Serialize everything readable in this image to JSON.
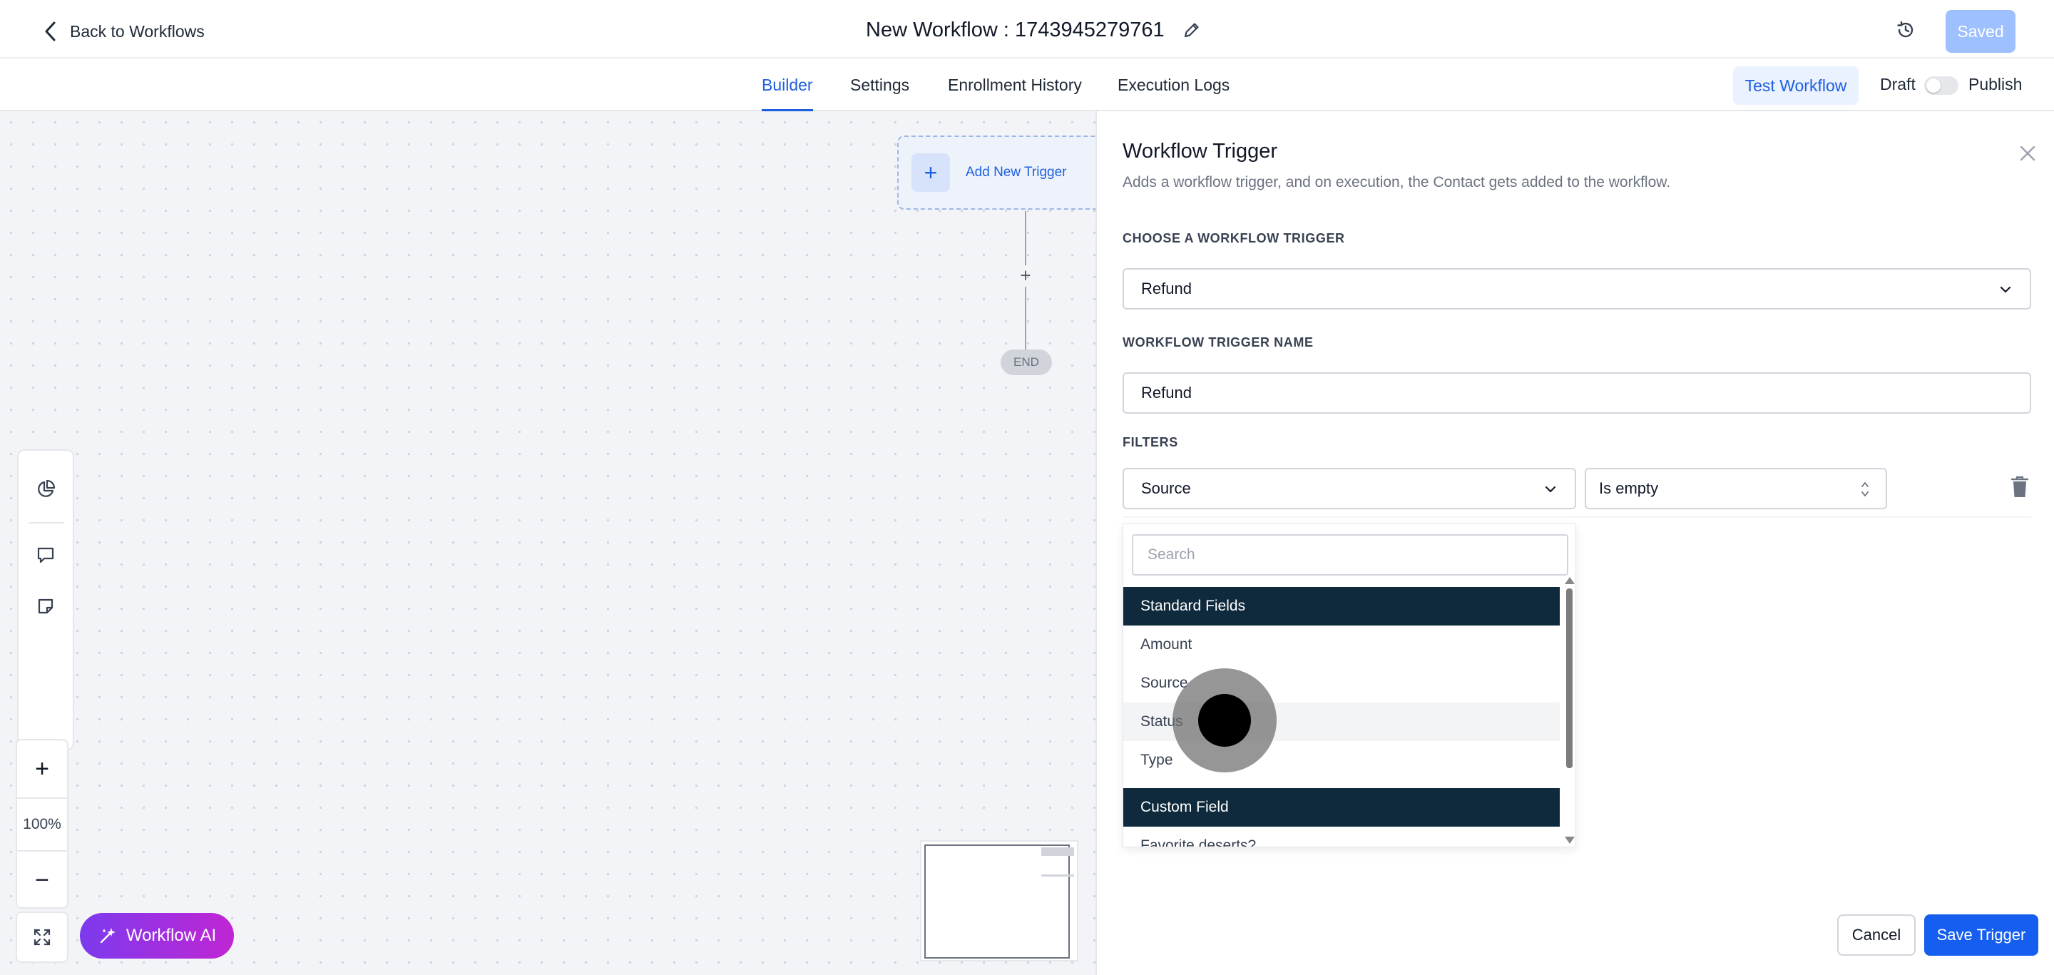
{
  "header": {
    "back_label": "Back to Workflows",
    "workflow_title": "New Workflow : 1743945279761",
    "saved_label": "Saved"
  },
  "tabs": [
    {
      "label": "Builder",
      "active": true
    },
    {
      "label": "Settings",
      "active": false
    },
    {
      "label": "Enrollment History",
      "active": false
    },
    {
      "label": "Execution Logs",
      "active": false
    }
  ],
  "toolbar": {
    "test_label": "Test Workflow",
    "draft_label": "Draft",
    "publish_label": "Publish",
    "published": false
  },
  "canvas": {
    "add_trigger_label": "Add New Trigger",
    "end_label": "END",
    "zoom_level": "100%",
    "ai_label": "Workflow AI"
  },
  "drawer": {
    "title": "Workflow Trigger",
    "description": "Adds a workflow trigger, and on execution, the Contact gets added to the workflow.",
    "choose_label": "CHOOSE A WORKFLOW TRIGGER",
    "trigger_value": "Refund",
    "name_label": "WORKFLOW TRIGGER NAME",
    "name_value": "Refund",
    "filters_label": "FILTERS",
    "filter_field": "Source",
    "filter_operator": "Is empty",
    "search_placeholder": "Search",
    "groups": [
      {
        "label": "Standard Fields",
        "items": [
          "Amount",
          "Source",
          "Status",
          "Type"
        ]
      },
      {
        "label": "Custom Field",
        "items": [
          "Favorite deserts?"
        ]
      }
    ],
    "hovered_item": "Status",
    "cancel_label": "Cancel",
    "save_label": "Save Trigger"
  },
  "colors": {
    "accent": "#1d5fe0",
    "saved_bg": "#9ec0ff",
    "group_header": "#0e2a3c",
    "ai_gradient_start": "#7c3aed",
    "ai_gradient_end": "#c026d3"
  }
}
